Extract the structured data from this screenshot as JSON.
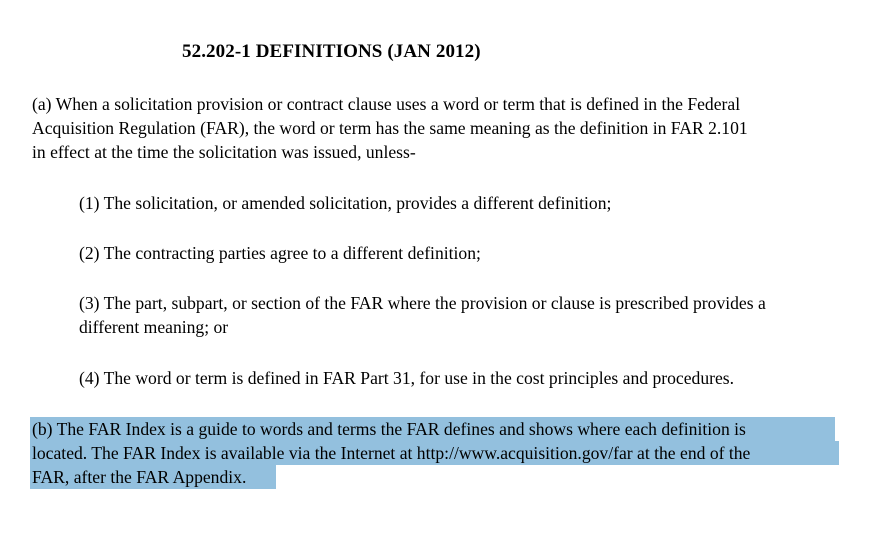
{
  "document": {
    "title": "52.202-1 DEFINITIONS (JAN 2012)",
    "para_a": [
      "(a) When a solicitation provision or contract clause uses a word or term that is defined in the Federal",
      "Acquisition Regulation (FAR), the word or term has the same meaning as the definition in FAR 2.101",
      "in effect at the time the solicitation was issued, unless-"
    ],
    "item_1": "(1) The solicitation, or amended solicitation, provides a different definition;",
    "item_2": "(2) The contracting parties agree to a different definition;",
    "item_3": [
      "(3) The part, subpart, or section of the FAR where the provision or clause is prescribed provides a",
      "different meaning; or"
    ],
    "item_4": "(4) The word or term is defined in FAR Part 31, for use in the cost principles and procedures.",
    "para_b": [
      "(b) The FAR Index is a guide to words and terms the FAR defines and shows where each definition is",
      "located. The FAR Index is available via the Internet at http://www.acquisition.gov/far at the end of the",
      "FAR, after the FAR Appendix."
    ]
  },
  "selection": {
    "highlight_color": "#93c0de",
    "selected_paragraph": "para_b"
  }
}
